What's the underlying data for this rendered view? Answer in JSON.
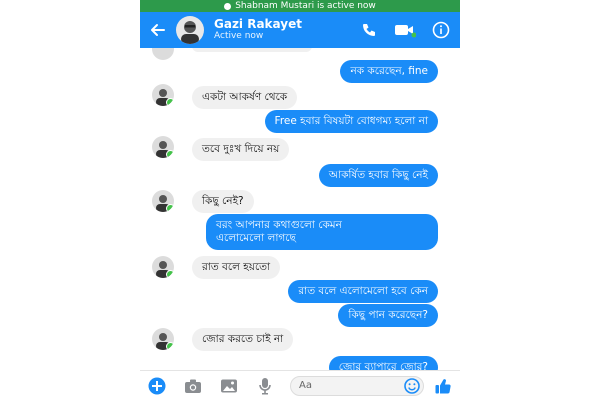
{
  "status_banner": {
    "text": "Shabnam Mustari is active now"
  },
  "header": {
    "name": "Gazi Rakayet",
    "status": "Active now"
  },
  "messages": [
    {
      "side": "out",
      "text": "নক করেছেন, fine"
    },
    {
      "side": "in",
      "text": "একটা আকর্ষণ থেকে"
    },
    {
      "side": "out",
      "text": "Free হবার বিষয়টা বোধগম্য হলো না"
    },
    {
      "side": "in",
      "text": "তবে দুঃখ দিয়ে নয়"
    },
    {
      "side": "out",
      "text": "আকর্ষিত হবার কিছু নেই"
    },
    {
      "side": "in",
      "text": "কিছু নেই?"
    },
    {
      "side": "out",
      "text_line1": "বরং আপনার কথাগুলো কেমন",
      "text_line2": "এলোমেলো লাগছে"
    },
    {
      "side": "in",
      "text": "রাত বলে হয়তো"
    },
    {
      "side": "out",
      "text": "রাত বলে এলোমেলো হবে কেন"
    },
    {
      "side": "out",
      "text": "কিছু পান করেছেন?"
    },
    {
      "side": "in",
      "text": "জোর করতে চাই না"
    },
    {
      "side": "out",
      "text": "জোর ব্যাপারে জোর?"
    }
  ],
  "composer": {
    "placeholder": "Aa"
  },
  "colors": {
    "accent": "#1a8cf8",
    "status_green": "#2d9a4b",
    "online": "#44c24a",
    "incoming_bg": "#f0f0f0"
  }
}
